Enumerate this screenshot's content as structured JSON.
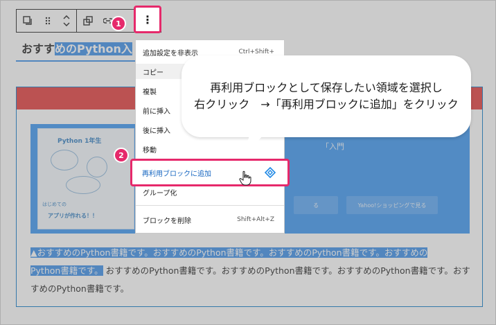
{
  "toolbar": {
    "more_label": "⋮"
  },
  "heading": {
    "prefix": "おすす",
    "selected": "めのPython入"
  },
  "banner": {
    "book_title": "Python 1年生",
    "book_tag": "はじめての",
    "book_sub": "アプリが作れる！！",
    "title": "「入門",
    "button_1": "る",
    "button_2": "Yahoo!ショッピングで見る"
  },
  "paragraph": {
    "selected_1": "▲おすすめのPython書籍です。おすすめのPython書籍です。おすすめのPython書籍です。おすすめの",
    "selected_2": "Python書籍です。",
    "rest": "おすすめのPython書籍です。おすすめのPython書籍です。おすすめのPython書籍です。おすすめのPython書籍です。"
  },
  "menu": {
    "items": [
      {
        "label": "追加設定を非表示",
        "shortcut": "Ctrl+Shift+"
      },
      {
        "label": "コピー",
        "shortcut": ""
      },
      {
        "label": "複製",
        "shortcut": ""
      },
      {
        "label": "前に挿入",
        "shortcut": ""
      },
      {
        "label": "後に挿入",
        "shortcut": ""
      },
      {
        "label": "移動",
        "shortcut": ""
      },
      {
        "label": "再利用ブロックに追加",
        "shortcut": ""
      },
      {
        "label": "グループ化",
        "shortcut": ""
      },
      {
        "label": "ブロックを削除",
        "shortcut": "Shift+Alt+Z"
      }
    ]
  },
  "callout": {
    "line1": "再利用ブロックとして保存したい領域を選択し",
    "line2": "右クリック　→「再利用ブロックに追加」をクリック"
  },
  "badges": {
    "step1": "1",
    "step2": "2"
  },
  "colors": {
    "accent_pink": "#e6296b",
    "selection_blue": "#3b8ee8",
    "menu_link_blue": "#1565c0"
  },
  "icons": [
    "duplicate-icon",
    "drag-handle-icon",
    "move-arrows-icon",
    "transform-icon",
    "link-icon",
    "more-vertical-icon",
    "reusable-diamond-icon",
    "hand-cursor-icon"
  ]
}
